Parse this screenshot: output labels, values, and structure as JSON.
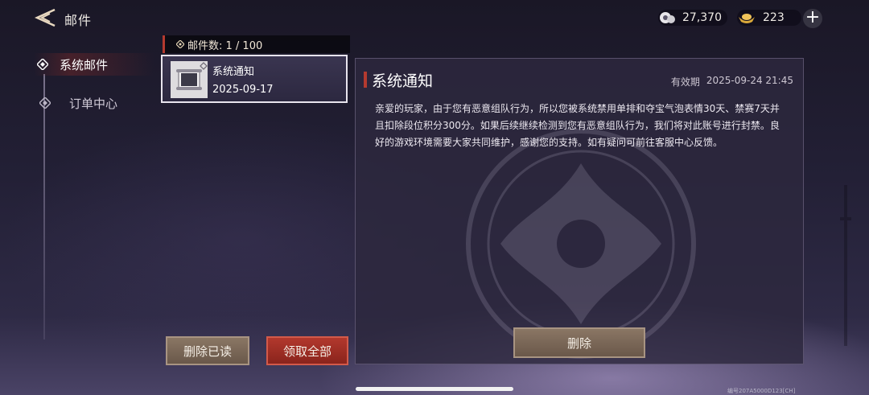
{
  "header": {
    "title": "邮件",
    "back_icon": "back-arrow-icon"
  },
  "currency": [
    {
      "icon": "silver-coin-icon",
      "value": "27,370"
    },
    {
      "icon": "gold-ingot-icon",
      "value": "223"
    }
  ],
  "add_button_label": "+",
  "sidebar": {
    "items": [
      {
        "label": "系统邮件",
        "active": true
      },
      {
        "label": "订单中心",
        "active": false
      }
    ]
  },
  "mail_list": {
    "count_label": "邮件数: 1 / 100",
    "items": [
      {
        "title": "系统通知",
        "date": "2025-09-17"
      }
    ]
  },
  "buttons": {
    "delete_read": "删除已读",
    "claim_all": "领取全部",
    "delete": "删除"
  },
  "detail": {
    "title": "系统通知",
    "expiry_label": "有效期",
    "expiry_value": "2025-09-24 21:45",
    "body": "亲爱的玩家，由于您有恶意组队行为，所以您被系统禁用单排和夺宝气泡表情30天、禁赛7天并且扣除段位积分300分。如果后续继续检测到您有恶意组队行为，我们将对此账号进行封禁。良好的游戏环境需要大家共同维护，感谢您的支持。如有疑问可前往客服中心反馈。"
  },
  "footnote": "编号207A5000D123[CH]",
  "colors": {
    "accent_red": "#b43a2f",
    "button_brown": "#7a6656",
    "panel_bg": "#2d283e"
  }
}
